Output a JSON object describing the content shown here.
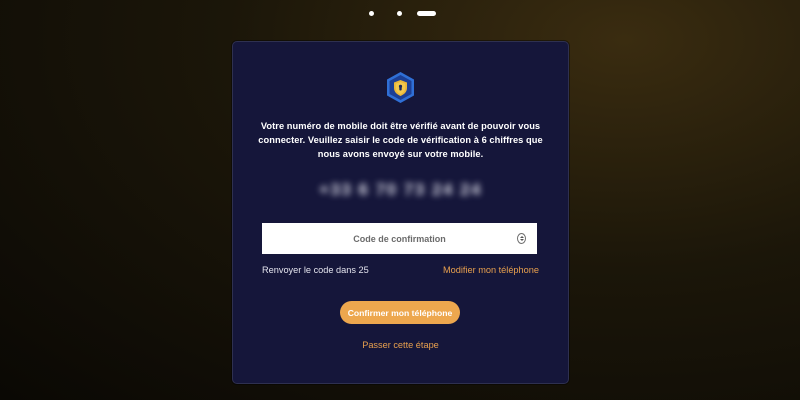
{
  "stepper": {
    "total_steps": 3,
    "current_step": 3
  },
  "card": {
    "message": "Votre numéro de mobile doit être vérifié avant de pouvoir vous connecter. Veuillez saisir le code de vérification à 6 chiffres que nous avons envoyé sur votre mobile.",
    "phone_number": "+33 6 70 73 24 24",
    "code_input": {
      "placeholder": "Code de confirmation",
      "value": ""
    },
    "resend_text": "Renvoyer le code dans 25",
    "modify_phone_link": "Modifier mon téléphone",
    "confirm_button": "Confirmer mon téléphone",
    "skip_link": "Passer cette étape"
  },
  "colors": {
    "accent": "#eda74e",
    "card_background": "#15163a",
    "shield_blue": "#2f6fd6",
    "shield_gold": "#e9b73a"
  },
  "icons": {
    "header": "shield-lock-icon"
  }
}
